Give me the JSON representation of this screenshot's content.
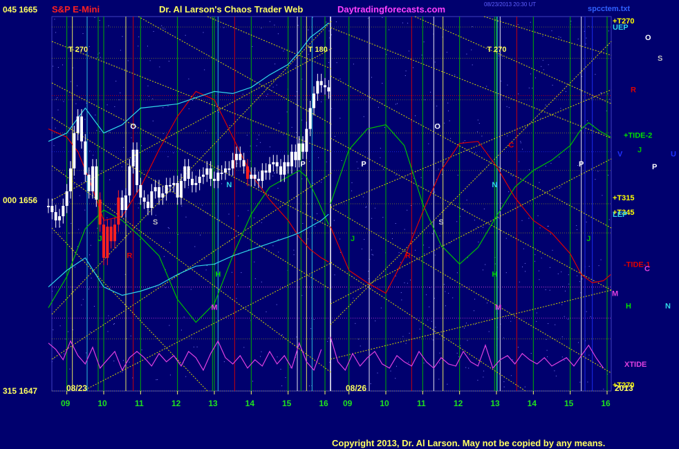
{
  "header": {
    "title_left": "S&P E-Mini",
    "title_center": "Dr. Al Larson's Chaos Trader Web",
    "site": "Daytradingforecasts.com",
    "timestamp": "08/23/2013 20:30 UT",
    "file": "spcctem.txt"
  },
  "footer": {
    "copyright": "Copyright 2013, Dr. Al Larson. May not be copied by any means."
  },
  "colors": {
    "background": "#00006e",
    "grid_yellow": "#d8d800",
    "grid_green": "#00b000",
    "red": "#e00000",
    "cyan": "#30d8e8",
    "magenta": "#e040e0",
    "white": "#ffffff",
    "blue": "#2030ff"
  },
  "chart_data": {
    "type": "line",
    "title": "S&P E-Mini",
    "ylim": [
      1647,
      1665
    ],
    "y_ticks": [
      {
        "angle": "045",
        "price": 1665
      },
      {
        "angle": "000",
        "price": 1656
      },
      {
        "angle": "315",
        "price": 1647
      }
    ],
    "x_hours_day1": [
      "09",
      "10",
      "11",
      "12",
      "13",
      "14",
      "15",
      "16"
    ],
    "x_hours_day2": [
      "09",
      "10",
      "11",
      "12",
      "13",
      "14",
      "15",
      "16"
    ],
    "date_labels": [
      "08/23",
      "08/26",
      "2013"
    ],
    "top_markers": [
      {
        "label": "T 270",
        "x_hour": 9.1
      },
      {
        "label": "T 180",
        "x_hour": 15.6
      },
      {
        "label": "T 270",
        "x_hour": 12.8,
        "day": 2
      }
    ],
    "right_labels": [
      {
        "text": "+T270",
        "color": "#ffff00",
        "price": 1664.8
      },
      {
        "text": "UEP",
        "color": "#30d8e8",
        "price": 1664.5
      },
      {
        "text": "O",
        "color": "#ffffff",
        "price": 1664.0
      },
      {
        "text": "S",
        "color": "#c0c0c0",
        "price": 1663.0
      },
      {
        "text": "R",
        "color": "#e00000",
        "price": 1661.5
      },
      {
        "text": "+TIDE-2",
        "color": "#00e000",
        "price": 1659.3
      },
      {
        "text": "V",
        "color": "#2030ff",
        "price": 1658.4
      },
      {
        "text": "J",
        "color": "#00c000",
        "price": 1658.6
      },
      {
        "text": "U",
        "color": "#2030ff",
        "price": 1658.4
      },
      {
        "text": "P",
        "color": "#ffffff",
        "price": 1657.8
      },
      {
        "text": "+T315",
        "color": "#ffff00",
        "price": 1656.3
      },
      {
        "text": "+T345",
        "color": "#ffff00",
        "price": 1655.6
      },
      {
        "text": "LEP",
        "color": "#30d8e8",
        "price": 1655.5
      },
      {
        "text": "-TIDE-1",
        "color": "#e00000",
        "price": 1653.1
      },
      {
        "text": "C",
        "color": "#e040e0",
        "price": 1652.9
      },
      {
        "text": "M",
        "color": "#e040e0",
        "price": 1651.7
      },
      {
        "text": "H",
        "color": "#00e000",
        "price": 1651.1
      },
      {
        "text": "N",
        "color": "#30d8e8",
        "price": 1651.1
      },
      {
        "text": "XTIDE",
        "color": "#e040e0",
        "price": 1648.3
      },
      {
        "text": "+T270",
        "color": "#ffff00",
        "price": 1647.3
      }
    ],
    "inline_labels": [
      {
        "text": "O",
        "color": "#ffffff",
        "day": 1,
        "hour": 10.8,
        "price": 1659.6
      },
      {
        "text": "O",
        "color": "#ffffff",
        "day": 2,
        "hour": 11.4,
        "price": 1659.6
      },
      {
        "text": "P",
        "color": "#ffffff",
        "day": 1,
        "hour": 15.4,
        "price": 1657.8
      },
      {
        "text": "P",
        "color": "#ffffff",
        "day": 2,
        "hour": 9.4,
        "price": 1657.8
      },
      {
        "text": "P",
        "color": "#ffffff",
        "day": 2,
        "hour": 15.3,
        "price": 1657.8
      },
      {
        "text": "N",
        "color": "#30d8e8",
        "day": 1,
        "hour": 13.4,
        "price": 1656.8
      },
      {
        "text": "N",
        "color": "#30d8e8",
        "day": 2,
        "hour": 12.95,
        "price": 1656.8
      },
      {
        "text": "S",
        "color": "#c0c0c0",
        "day": 1,
        "hour": 11.4,
        "price": 1655.0
      },
      {
        "text": "S",
        "color": "#c0c0c0",
        "day": 2,
        "hour": 11.5,
        "price": 1655.0
      },
      {
        "text": "J",
        "color": "#00c000",
        "day": 1,
        "hour": 9.9,
        "price": 1654.2
      },
      {
        "text": "J",
        "color": "#00c000",
        "day": 2,
        "hour": 9.1,
        "price": 1654.2
      },
      {
        "text": "J",
        "color": "#00c000",
        "day": 2,
        "hour": 15.5,
        "price": 1654.2
      },
      {
        "text": "R",
        "color": "#e00000",
        "day": 1,
        "hour": 10.7,
        "price": 1653.4
      },
      {
        "text": "R",
        "color": "#e00000",
        "day": 2,
        "hour": 10.6,
        "price": 1653.4
      },
      {
        "text": "C",
        "color": "#e00000",
        "day": 2,
        "hour": 13.4,
        "price": 1658.7
      },
      {
        "text": "H",
        "color": "#00e000",
        "day": 1,
        "hour": 13.1,
        "price": 1652.5
      },
      {
        "text": "H",
        "color": "#00e000",
        "day": 2,
        "hour": 12.95,
        "price": 1652.5
      },
      {
        "text": "M",
        "color": "#e040e0",
        "day": 1,
        "hour": 13.0,
        "price": 1650.9
      },
      {
        "text": "M",
        "color": "#e040e0",
        "day": 2,
        "hour": 13.05,
        "price": 1650.9
      }
    ],
    "series": [
      {
        "name": "S&P E-Mini price",
        "type": "candles",
        "x_hour": [
          8.5,
          8.6,
          8.7,
          8.8,
          8.9,
          9.0,
          9.1,
          9.2,
          9.3,
          9.4,
          9.5,
          9.6,
          9.7,
          9.8,
          9.9,
          10.0,
          10.1,
          10.2,
          10.3,
          10.4,
          10.5,
          10.6,
          10.7,
          10.8,
          10.9,
          11.0,
          11.1,
          11.2,
          11.3,
          11.4,
          11.5,
          11.6,
          11.7,
          11.8,
          11.9,
          12.0,
          12.1,
          12.2,
          12.3,
          12.4,
          12.5,
          12.6,
          12.7,
          12.8,
          12.9,
          13.0,
          13.1,
          13.2,
          13.3,
          13.4,
          13.5,
          13.6,
          13.7,
          13.8,
          13.9,
          14.0,
          14.1,
          14.2,
          14.3,
          14.4,
          14.5,
          14.6,
          14.7,
          14.8,
          14.9,
          15.0,
          15.1,
          15.2,
          15.3,
          15.4,
          15.5,
          15.6,
          15.7,
          15.8,
          15.9,
          16.0,
          16.1
        ],
        "close": [
          1655.9,
          1655.6,
          1655.2,
          1655.4,
          1655.9,
          1656.6,
          1657.7,
          1659.4,
          1660.2,
          1659.0,
          1657.4,
          1656.6,
          1657.8,
          1656.2,
          1655.0,
          1653.4,
          1654.9,
          1654.2,
          1655.0,
          1656.3,
          1655.7,
          1656.4,
          1657.8,
          1658.6,
          1656.9,
          1656.3,
          1656.1,
          1655.8,
          1656.6,
          1656.8,
          1656.3,
          1656.5,
          1656.9,
          1656.9,
          1657.0,
          1656.3,
          1657.1,
          1657.8,
          1657.2,
          1656.9,
          1657.0,
          1657.3,
          1657.4,
          1657.7,
          1657.2,
          1657.1,
          1657.5,
          1657.5,
          1657.7,
          1657.7,
          1658.1,
          1658.4,
          1658.1,
          1657.8,
          1657.2,
          1657.4,
          1657.2,
          1657.1,
          1657.6,
          1657.5,
          1657.9,
          1658.0,
          1657.8,
          1657.4,
          1658.0,
          1657.8,
          1658.5,
          1658.1,
          1658.9,
          1658.5,
          1659.6,
          1660.6,
          1661.3,
          1661.9,
          1661.7,
          1661.6,
          1661.4
        ]
      },
      {
        "name": "TIDE-2",
        "color": "#00c000",
        "day": [
          1,
          1,
          1,
          1,
          1,
          1,
          1,
          1,
          1,
          1,
          1,
          1,
          1,
          1,
          1,
          1,
          1,
          1,
          2,
          2,
          2,
          2,
          2,
          2,
          2,
          2,
          2,
          2,
          2,
          2,
          2,
          2,
          2,
          2,
          2,
          2
        ],
        "x_hour": [
          8.5,
          9.0,
          9.5,
          10.0,
          10.5,
          11.0,
          11.5,
          12.0,
          12.5,
          13.0,
          13.5,
          14.0,
          14.5,
          15.0,
          15.3,
          15.5,
          15.8,
          16.1,
          8.5,
          9.0,
          9.5,
          10.0,
          10.5,
          11.0,
          11.5,
          12.0,
          12.5,
          13.0,
          13.5,
          14.0,
          14.5,
          15.0,
          15.3,
          15.5,
          15.8,
          16.1
        ],
        "values": [
          1651.0,
          1652.5,
          1654.8,
          1655.7,
          1655.2,
          1654.4,
          1653.5,
          1651.4,
          1650.3,
          1651.2,
          1653.5,
          1655.5,
          1656.8,
          1657.3,
          1657.6,
          1657.3,
          1656.2,
          1655.0,
          1656.0,
          1658.6,
          1659.6,
          1659.8,
          1658.8,
          1656.0,
          1654.0,
          1653.1,
          1653.9,
          1655.4,
          1656.8,
          1657.6,
          1658.1,
          1658.8,
          1659.6,
          1659.9,
          1659.5,
          1659.2
        ]
      },
      {
        "name": "TIDE-1",
        "color": "#e00000",
        "day": [
          1,
          1,
          1,
          1,
          1,
          1,
          1,
          1,
          1,
          1,
          1,
          1,
          1,
          1,
          1,
          1,
          1,
          1,
          1,
          2,
          2,
          2,
          2,
          2,
          2,
          2,
          2,
          2,
          2,
          2,
          2,
          2,
          2,
          2,
          2,
          2,
          2
        ],
        "x_hour": [
          8.5,
          9.0,
          9.3,
          9.6,
          10.0,
          10.5,
          11.0,
          11.5,
          12.0,
          12.5,
          13.0,
          13.5,
          14.0,
          14.5,
          15.0,
          15.3,
          15.6,
          15.9,
          16.1,
          8.5,
          9.0,
          9.5,
          10.0,
          10.5,
          11.0,
          11.5,
          12.0,
          12.5,
          13.0,
          13.5,
          14.0,
          14.5,
          15.0,
          15.3,
          15.6,
          15.9,
          16.1
        ],
        "values": [
          1659.6,
          1659.2,
          1658.5,
          1657.2,
          1655.2,
          1655.4,
          1656.8,
          1658.6,
          1660.2,
          1661.4,
          1661.0,
          1659.2,
          1657.4,
          1656.2,
          1655.2,
          1654.4,
          1653.8,
          1653.4,
          1653.2,
          1654.9,
          1652.8,
          1652.2,
          1651.7,
          1653.4,
          1655.6,
          1657.6,
          1658.9,
          1659.0,
          1657.8,
          1656.3,
          1655.2,
          1654.6,
          1653.6,
          1652.6,
          1652.2,
          1652.3,
          1652.6
        ]
      },
      {
        "name": "UEP",
        "color": "#30d8e8",
        "day": [
          1,
          1,
          1,
          1,
          1,
          1,
          1,
          1,
          1,
          1,
          1,
          1,
          1,
          1,
          1,
          1,
          1,
          1
        ],
        "x_hour": [
          8.5,
          9.0,
          9.5,
          10.0,
          10.5,
          11.0,
          11.5,
          12.0,
          12.5,
          13.0,
          13.5,
          14.0,
          14.5,
          15.0,
          15.3,
          15.6,
          15.9,
          16.1
        ],
        "values": [
          1659.0,
          1659.4,
          1660.6,
          1659.4,
          1659.8,
          1660.6,
          1660.7,
          1660.8,
          1661.1,
          1661.4,
          1661.3,
          1661.6,
          1662.2,
          1662.7,
          1663.3,
          1664.0,
          1664.4,
          1664.7
        ]
      },
      {
        "name": "LEP",
        "color": "#30d8e8",
        "day": [
          1,
          1,
          1,
          1,
          1,
          1,
          1,
          1,
          1,
          1,
          1,
          1,
          1,
          1,
          1,
          1,
          1,
          1
        ],
        "x_hour": [
          8.5,
          9.0,
          9.5,
          10.0,
          10.5,
          11.0,
          11.5,
          12.0,
          12.5,
          13.0,
          13.5,
          14.0,
          14.5,
          15.0,
          15.3,
          15.6,
          15.9,
          16.1
        ],
        "values": [
          1652.0,
          1652.8,
          1653.4,
          1652.0,
          1651.6,
          1651.8,
          1652.1,
          1652.6,
          1653.0,
          1653.1,
          1653.5,
          1653.8,
          1654.1,
          1654.4,
          1654.6,
          1654.9,
          1655.2,
          1655.5
        ]
      },
      {
        "name": "XTIDE",
        "color": "#e040e0",
        "day": [
          1,
          1,
          1,
          1,
          1,
          1,
          1,
          1,
          1,
          1,
          1,
          1,
          1,
          1,
          1,
          1,
          1,
          1,
          1,
          1,
          1,
          1,
          1,
          1,
          1,
          1,
          1,
          1,
          1,
          1,
          1,
          1,
          1,
          1,
          1,
          1,
          1,
          1,
          2,
          2,
          2,
          2,
          2,
          2,
          2,
          2,
          2,
          2,
          2,
          2,
          2,
          2,
          2,
          2,
          2,
          2,
          2,
          2,
          2,
          2,
          2,
          2,
          2,
          2,
          2,
          2,
          2,
          2,
          2,
          2,
          2,
          2,
          2,
          2,
          2,
          2
        ],
        "x_hour": [
          8.5,
          8.7,
          8.9,
          9.1,
          9.3,
          9.5,
          9.7,
          9.9,
          10.1,
          10.3,
          10.5,
          10.7,
          10.9,
          11.1,
          11.3,
          11.5,
          11.7,
          11.9,
          12.1,
          12.3,
          12.5,
          12.7,
          12.9,
          13.1,
          13.3,
          13.5,
          13.7,
          13.9,
          14.1,
          14.3,
          14.5,
          14.7,
          14.9,
          15.1,
          15.3,
          15.5,
          15.7,
          15.9,
          8.5,
          8.7,
          8.9,
          9.1,
          9.3,
          9.5,
          9.7,
          9.9,
          10.1,
          10.3,
          10.5,
          10.7,
          10.9,
          11.1,
          11.3,
          11.5,
          11.7,
          11.9,
          12.1,
          12.3,
          12.5,
          12.7,
          12.9,
          13.1,
          13.3,
          13.5,
          13.7,
          13.9,
          14.1,
          14.3,
          14.5,
          14.7,
          14.9,
          15.1,
          15.3,
          15.5,
          15.7,
          15.9
        ],
        "values": [
          1649.3,
          1649.0,
          1648.5,
          1649.4,
          1648.7,
          1648.3,
          1649.1,
          1648.1,
          1648.5,
          1648.9,
          1648.0,
          1648.6,
          1648.9,
          1648.6,
          1648.2,
          1648.8,
          1648.4,
          1648.7,
          1648.2,
          1648.9,
          1648.6,
          1648.0,
          1648.8,
          1649.4,
          1648.6,
          1648.3,
          1648.7,
          1648.1,
          1648.5,
          1648.2,
          1648.9,
          1648.3,
          1648.7,
          1648.1,
          1649.3,
          1648.4,
          1648.0,
          1649.0,
          1649.6,
          1648.4,
          1648.0,
          1648.8,
          1648.2,
          1648.6,
          1648.9,
          1648.3,
          1648.1,
          1648.7,
          1648.4,
          1648.2,
          1648.9,
          1648.4,
          1648.1,
          1648.6,
          1648.3,
          1648.2,
          1648.9,
          1648.4,
          1648.2,
          1649.2,
          1648.1,
          1648.5,
          1648.7,
          1648.3,
          1648.8,
          1648.5,
          1648.3,
          1648.6,
          1648.2,
          1648.4,
          1648.6,
          1648.2,
          1648.7,
          1649.2,
          1648.6,
          1648.1
        ]
      }
    ]
  }
}
